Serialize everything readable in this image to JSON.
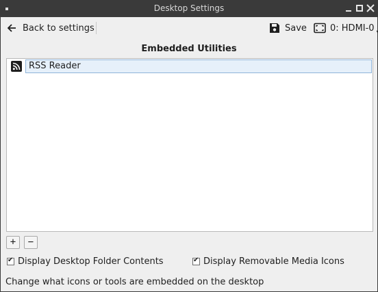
{
  "window": {
    "title": "Desktop Settings"
  },
  "toolbar": {
    "back_label": "Back to settings",
    "save_label": "Save",
    "monitor_label": "0: HDMI-0"
  },
  "section": {
    "title": "Embedded Utilities"
  },
  "utilities": {
    "items": [
      {
        "label": "RSS Reader",
        "icon": "rss-icon",
        "selected": true
      }
    ]
  },
  "list_buttons": {
    "add": "+",
    "remove": "−"
  },
  "options": {
    "folder_contents": {
      "label": "Display Desktop Folder Contents",
      "checked": true
    },
    "removable_media": {
      "label": "Display Removable Media Icons",
      "checked": true
    }
  },
  "status": {
    "text": "Change what icons or tools are embedded on the desktop"
  },
  "colors": {
    "titlebar": "#3a3a3a",
    "selection": "#e6f0fa",
    "selection_border": "#8fb4d9"
  }
}
